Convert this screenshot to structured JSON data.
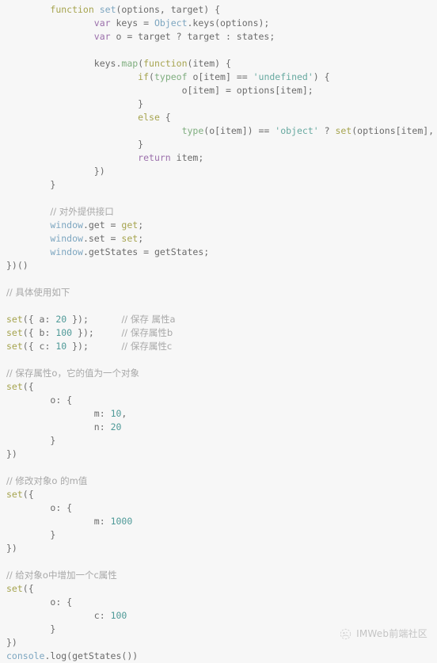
{
  "editor": {
    "language": "javascript",
    "background_color": "#f7f7f7",
    "default_text_color": "#6b6b6b",
    "font_size_px": 11.5,
    "line_height_px": 17,
    "colors": {
      "keyword": "#a6a44f",
      "keyword_control": "#9b6fab",
      "function_call": "#7da6c0",
      "builtin": "#7fae7f",
      "string": "#67a9a0",
      "number": "#4f9a98",
      "comment": "#a8a8a8",
      "plain": "#6b6b6b"
    }
  },
  "code": {
    "lines": [
      {
        "indent": 2,
        "tokens": [
          {
            "t": "function",
            "c": "t-kw"
          },
          {
            "t": " ",
            "c": "t-plain"
          },
          {
            "t": "set",
            "c": "t-fn"
          },
          {
            "t": "(options, target) {",
            "c": "t-plain"
          }
        ]
      },
      {
        "indent": 4,
        "tokens": [
          {
            "t": "var",
            "c": "t-kw2"
          },
          {
            "t": " keys = ",
            "c": "t-plain"
          },
          {
            "t": "Object",
            "c": "t-fn"
          },
          {
            "t": ".keys(options);",
            "c": "t-plain"
          }
        ]
      },
      {
        "indent": 4,
        "tokens": [
          {
            "t": "var",
            "c": "t-kw2"
          },
          {
            "t": " o = target ? target : states;",
            "c": "t-plain"
          }
        ]
      },
      {
        "indent": 0,
        "tokens": []
      },
      {
        "indent": 4,
        "tokens": [
          {
            "t": "keys.",
            "c": "t-plain"
          },
          {
            "t": "map",
            "c": "t-green"
          },
          {
            "t": "(",
            "c": "t-plain"
          },
          {
            "t": "function",
            "c": "t-kw"
          },
          {
            "t": "(item) {",
            "c": "t-plain"
          }
        ]
      },
      {
        "indent": 6,
        "tokens": [
          {
            "t": "if",
            "c": "t-kw"
          },
          {
            "t": "(",
            "c": "t-plain"
          },
          {
            "t": "typeof",
            "c": "t-green"
          },
          {
            "t": " o[item] == ",
            "c": "t-plain"
          },
          {
            "t": "'undefined'",
            "c": "t-str"
          },
          {
            "t": ") {",
            "c": "t-plain"
          }
        ]
      },
      {
        "indent": 8,
        "tokens": [
          {
            "t": "o[item] = options[item];",
            "c": "t-plain"
          }
        ]
      },
      {
        "indent": 6,
        "tokens": [
          {
            "t": "}",
            "c": "t-plain"
          }
        ]
      },
      {
        "indent": 6,
        "tokens": [
          {
            "t": "else",
            "c": "t-kw"
          },
          {
            "t": " {",
            "c": "t-plain"
          }
        ]
      },
      {
        "indent": 8,
        "tokens": [
          {
            "t": "type",
            "c": "t-green"
          },
          {
            "t": "(o[item]) == ",
            "c": "t-plain"
          },
          {
            "t": "'object'",
            "c": "t-str"
          },
          {
            "t": " ? ",
            "c": "t-plain"
          },
          {
            "t": "set",
            "c": "t-kw"
          },
          {
            "t": "(options[item], o[item]) : o[item]",
            "c": "t-plain"
          }
        ]
      },
      {
        "indent": 6,
        "tokens": [
          {
            "t": "}",
            "c": "t-plain"
          }
        ]
      },
      {
        "indent": 6,
        "tokens": [
          {
            "t": "return",
            "c": "t-kw2"
          },
          {
            "t": " item;",
            "c": "t-plain"
          }
        ]
      },
      {
        "indent": 4,
        "tokens": [
          {
            "t": "})",
            "c": "t-plain"
          }
        ]
      },
      {
        "indent": 2,
        "tokens": [
          {
            "t": "}",
            "c": "t-plain"
          }
        ]
      },
      {
        "indent": 0,
        "tokens": []
      },
      {
        "indent": 2,
        "tokens": [
          {
            "t": "// 对外提供接口",
            "c": "t-comment t-cn"
          }
        ]
      },
      {
        "indent": 2,
        "tokens": [
          {
            "t": "window",
            "c": "t-fn"
          },
          {
            "t": ".get = ",
            "c": "t-plain"
          },
          {
            "t": "get",
            "c": "t-kw"
          },
          {
            "t": ";",
            "c": "t-plain"
          }
        ]
      },
      {
        "indent": 2,
        "tokens": [
          {
            "t": "window",
            "c": "t-fn"
          },
          {
            "t": ".set = ",
            "c": "t-plain"
          },
          {
            "t": "set",
            "c": "t-kw"
          },
          {
            "t": ";",
            "c": "t-plain"
          }
        ]
      },
      {
        "indent": 2,
        "tokens": [
          {
            "t": "window",
            "c": "t-fn"
          },
          {
            "t": ".getStates = getStates;",
            "c": "t-plain"
          }
        ]
      },
      {
        "indent": 0,
        "tokens": [
          {
            "t": "})()",
            "c": "t-plain"
          }
        ]
      },
      {
        "indent": 0,
        "tokens": []
      },
      {
        "indent": 0,
        "tokens": [
          {
            "t": "// 具体使用如下",
            "c": "t-comment t-cn"
          }
        ]
      },
      {
        "indent": 0,
        "tokens": []
      },
      {
        "indent": 0,
        "tokens": [
          {
            "t": "set",
            "c": "t-kw"
          },
          {
            "t": "({ a: ",
            "c": "t-plain"
          },
          {
            "t": "20",
            "c": "t-num"
          },
          {
            "t": " });",
            "c": "t-plain"
          },
          {
            "t": "      ",
            "c": "t-plain"
          },
          {
            "t": "// 保存 属性a",
            "c": "t-comment t-cn"
          }
        ]
      },
      {
        "indent": 0,
        "tokens": [
          {
            "t": "set",
            "c": "t-kw"
          },
          {
            "t": "({ b: ",
            "c": "t-plain"
          },
          {
            "t": "100",
            "c": "t-num"
          },
          {
            "t": " });",
            "c": "t-plain"
          },
          {
            "t": "     ",
            "c": "t-plain"
          },
          {
            "t": "// 保存属性b",
            "c": "t-comment t-cn"
          }
        ]
      },
      {
        "indent": 0,
        "tokens": [
          {
            "t": "set",
            "c": "t-kw"
          },
          {
            "t": "({ c: ",
            "c": "t-plain"
          },
          {
            "t": "10",
            "c": "t-num"
          },
          {
            "t": " });",
            "c": "t-plain"
          },
          {
            "t": "      ",
            "c": "t-plain"
          },
          {
            "t": "// 保存属性c",
            "c": "t-comment t-cn"
          }
        ]
      },
      {
        "indent": 0,
        "tokens": []
      },
      {
        "indent": 0,
        "tokens": [
          {
            "t": "// 保存属性o，它的值为一个对象",
            "c": "t-comment t-cn"
          }
        ]
      },
      {
        "indent": 0,
        "tokens": [
          {
            "t": "set",
            "c": "t-kw"
          },
          {
            "t": "({",
            "c": "t-plain"
          }
        ]
      },
      {
        "indent": 2,
        "tokens": [
          {
            "t": "o: {",
            "c": "t-plain"
          }
        ]
      },
      {
        "indent": 4,
        "tokens": [
          {
            "t": "m: ",
            "c": "t-plain"
          },
          {
            "t": "10",
            "c": "t-num"
          },
          {
            "t": ",",
            "c": "t-plain"
          }
        ]
      },
      {
        "indent": 4,
        "tokens": [
          {
            "t": "n: ",
            "c": "t-plain"
          },
          {
            "t": "20",
            "c": "t-num"
          }
        ]
      },
      {
        "indent": 2,
        "tokens": [
          {
            "t": "}",
            "c": "t-plain"
          }
        ]
      },
      {
        "indent": 0,
        "tokens": [
          {
            "t": "})",
            "c": "t-plain"
          }
        ]
      },
      {
        "indent": 0,
        "tokens": []
      },
      {
        "indent": 0,
        "tokens": [
          {
            "t": "// 修改对象o 的m值",
            "c": "t-comment t-cn"
          }
        ]
      },
      {
        "indent": 0,
        "tokens": [
          {
            "t": "set",
            "c": "t-kw"
          },
          {
            "t": "({",
            "c": "t-plain"
          }
        ]
      },
      {
        "indent": 2,
        "tokens": [
          {
            "t": "o: {",
            "c": "t-plain"
          }
        ]
      },
      {
        "indent": 4,
        "tokens": [
          {
            "t": "m: ",
            "c": "t-plain"
          },
          {
            "t": "1000",
            "c": "t-num"
          }
        ]
      },
      {
        "indent": 2,
        "tokens": [
          {
            "t": "}",
            "c": "t-plain"
          }
        ]
      },
      {
        "indent": 0,
        "tokens": [
          {
            "t": "})",
            "c": "t-plain"
          }
        ]
      },
      {
        "indent": 0,
        "tokens": []
      },
      {
        "indent": 0,
        "tokens": [
          {
            "t": "// 给对象o中增加一个c属性",
            "c": "t-comment t-cn"
          }
        ]
      },
      {
        "indent": 0,
        "tokens": [
          {
            "t": "set",
            "c": "t-kw"
          },
          {
            "t": "({",
            "c": "t-plain"
          }
        ]
      },
      {
        "indent": 2,
        "tokens": [
          {
            "t": "o: {",
            "c": "t-plain"
          }
        ]
      },
      {
        "indent": 4,
        "tokens": [
          {
            "t": "c: ",
            "c": "t-plain"
          },
          {
            "t": "100",
            "c": "t-num"
          }
        ]
      },
      {
        "indent": 2,
        "tokens": [
          {
            "t": "}",
            "c": "t-plain"
          }
        ]
      },
      {
        "indent": 0,
        "tokens": [
          {
            "t": "})",
            "c": "t-plain"
          }
        ]
      },
      {
        "indent": 0,
        "tokens": [
          {
            "t": "console",
            "c": "t-fn"
          },
          {
            "t": ".log(getStates())",
            "c": "t-plain"
          }
        ]
      }
    ],
    "plain_text": "    function set(options, target) {\n        var keys = Object.keys(options);\n        var o = target ? target : states;\n\n        keys.map(function(item) {\n            if(typeof o[item] == 'undefined') {\n                o[item] = options[item];\n            }\n            else {\n                type(o[item]) == 'object' ? set(options[item], o[item]) : o[item]\n            }\n            return item;\n        })\n    }\n\n    // 对外提供接口\n    window.get = get;\n    window.set = set;\n    window.getStates = getStates;\n})()\n\n// 具体使用如下\n\nset({ a: 20 });      // 保存 属性a\nset({ b: 100 });     // 保存属性b\nset({ c: 10 });      // 保存属性c\n\n// 保存属性o，它的值为一个对象\nset({\n    o: {\n        m: 10,\n        n: 20\n    }\n})\n\n// 修改对象o 的m值\nset({\n    o: {\n        m: 1000\n    }\n})\n\n// 给对象o中增加一个c属性\nset({\n    o: {\n        c: 100\n    }\n})\nconsole.log(getStates())"
  },
  "watermark": {
    "text": "IMWeb前端社区",
    "logo_icon": "imweb-logo-icon",
    "color": "#9a9a9a"
  }
}
